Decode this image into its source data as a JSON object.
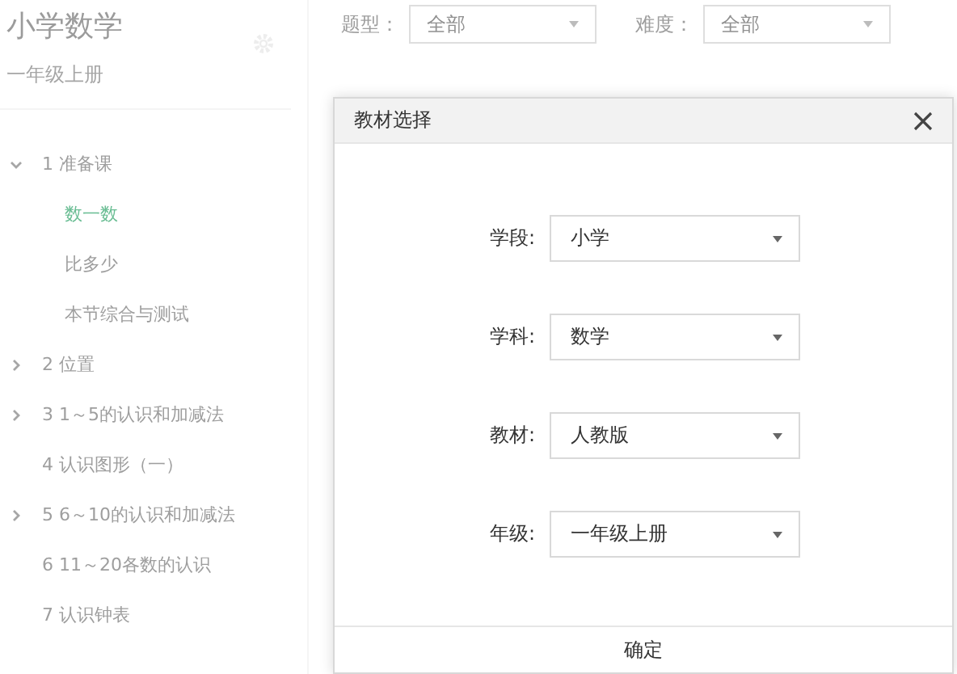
{
  "sidebar": {
    "title": "小学数学",
    "subtitle": "一年级上册",
    "tree": [
      {
        "label": "1 准备课",
        "kind": "folder",
        "expanded": true,
        "children": [
          {
            "label": "数一数",
            "selected": true
          },
          {
            "label": "比多少",
            "selected": false
          },
          {
            "label": "本节综合与测试",
            "selected": false
          }
        ]
      },
      {
        "label": "2 位置",
        "kind": "folder",
        "expanded": false
      },
      {
        "label": "3 1～5的认识和加减法",
        "kind": "folder",
        "expanded": false
      },
      {
        "label": "4 认识图形（一）",
        "kind": "item",
        "expanded": false
      },
      {
        "label": "5 6～10的认识和加减法",
        "kind": "folder",
        "expanded": false
      },
      {
        "label": "6 11～20各数的认识",
        "kind": "item",
        "expanded": false
      },
      {
        "label": "7 认识钟表",
        "kind": "item",
        "expanded": false
      }
    ]
  },
  "filters": [
    {
      "label": "题型：",
      "value": "全部"
    },
    {
      "label": "难度：",
      "value": "全部"
    }
  ],
  "dialog": {
    "title": "教材选择",
    "fields": [
      {
        "label": "学段:",
        "value": "小学"
      },
      {
        "label": "学科:",
        "value": "数学"
      },
      {
        "label": "教材:",
        "value": "人教版"
      },
      {
        "label": "年级:",
        "value": "一年级上册"
      }
    ],
    "confirm": "确定"
  }
}
